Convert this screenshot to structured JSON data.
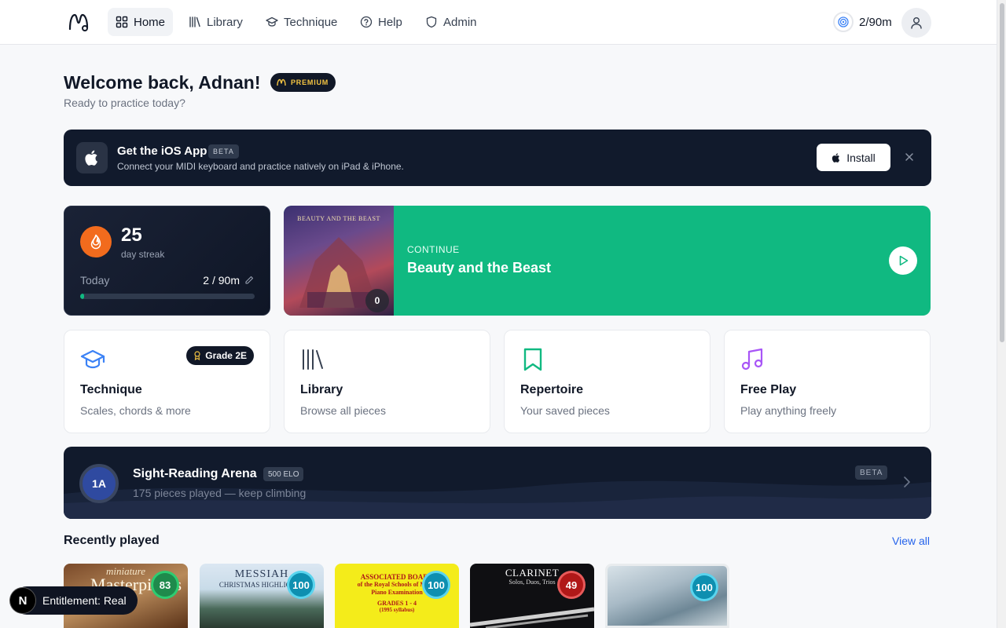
{
  "nav": {
    "items": [
      {
        "label": "Home",
        "icon": "grid-icon"
      },
      {
        "label": "Library",
        "icon": "library-icon"
      },
      {
        "label": "Technique",
        "icon": "graduation-cap-icon"
      },
      {
        "label": "Help",
        "icon": "help-circle-icon"
      },
      {
        "label": "Admin",
        "icon": "shield-icon"
      }
    ],
    "goal": "2/90m"
  },
  "welcome": {
    "title": "Welcome back, Adnan!",
    "badge": "PREMIUM",
    "subtitle": "Ready to practice today?"
  },
  "ios_banner": {
    "title": "Get the iOS App",
    "badge": "BETA",
    "subtitle": "Connect your MIDI keyboard and practice natively on iPad & iPhone.",
    "install_label": "Install"
  },
  "streak": {
    "count": "25",
    "label": "day streak",
    "today_label": "Today",
    "today_value": "2 / 90m",
    "progress_fraction": 0.022
  },
  "continue_card": {
    "label": "CONTINUE",
    "title": "Beauty and the Beast",
    "cover_text": "BEAUTY AND THE BEAST",
    "cover_score": "0"
  },
  "features": [
    {
      "title": "Technique",
      "subtitle": "Scales, chords & more",
      "badge": "Grade 2E",
      "color": "#3b82f6"
    },
    {
      "title": "Library",
      "subtitle": "Browse all pieces",
      "color": "#374151"
    },
    {
      "title": "Repertoire",
      "subtitle": "Your saved pieces",
      "color": "#10b981"
    },
    {
      "title": "Free Play",
      "subtitle": "Play anything freely",
      "color": "#a855f7"
    }
  ],
  "arena": {
    "rank": "1A",
    "title": "Sight-Reading Arena",
    "elo": "500 ELO",
    "subtitle": "175 pieces played — keep climbing",
    "badge": "BETA"
  },
  "recent": {
    "title": "Recently played",
    "view_all": "View all",
    "items": [
      {
        "cover_line1": "miniature",
        "cover_line2": "Masterpieces",
        "score": "83"
      },
      {
        "cover_line1": "MESSIAH",
        "cover_line2": "CHRISTMAS HIGHLIGHTS",
        "score": "100"
      },
      {
        "cover_line1": "ASSOCIATED BOARD",
        "cover_line2": "of the Royal Schools of Music",
        "cover_line3": "Piano Examination",
        "cover_line4": "GRADES 1 - 4",
        "cover_line5": "(1995 syllabus)",
        "score": "100"
      },
      {
        "cover_line1": "CLARINET",
        "cover_line2": "Solos, Duos, Trios",
        "score": "49"
      },
      {
        "score": "100"
      }
    ]
  },
  "dev_badge": {
    "letter": "N",
    "label": "Entitlement: Real"
  }
}
